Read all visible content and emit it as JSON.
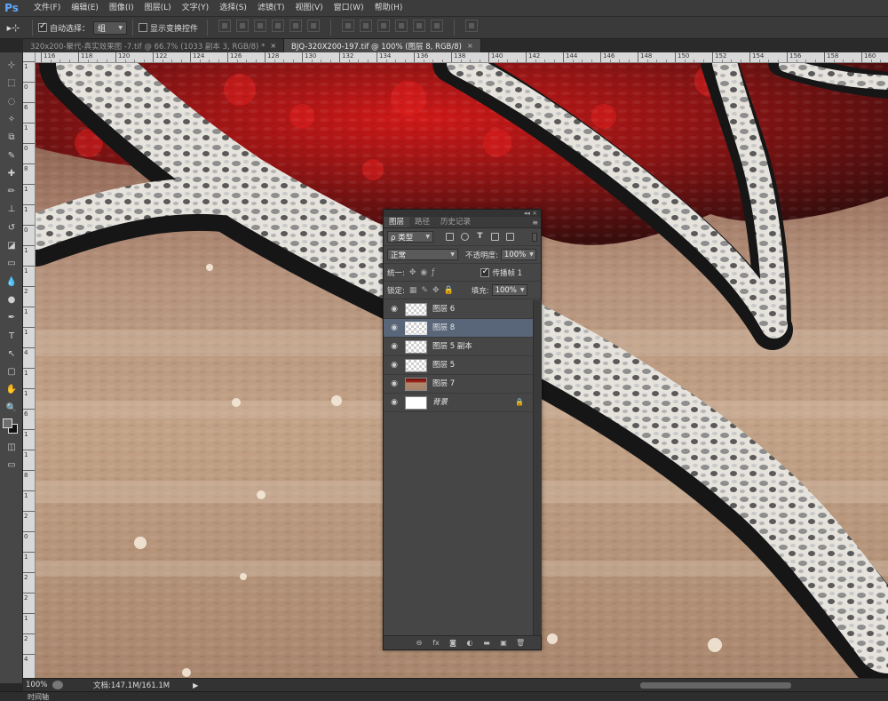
{
  "app": {
    "logo": "Ps"
  },
  "menus": [
    "文件(F)",
    "编辑(E)",
    "图像(I)",
    "图层(L)",
    "文字(Y)",
    "选择(S)",
    "滤镜(T)",
    "视图(V)",
    "窗口(W)",
    "帮助(H)"
  ],
  "options": {
    "move_tool_glyph": "▸⊹",
    "auto_select_label": "自动选择：",
    "auto_select_checked": true,
    "auto_select_target": "组",
    "show_transform_label": "显示变换控件",
    "show_transform_checked": false
  },
  "tabs": [
    {
      "label": "320x200-聚代-真实效果图 -7.tif @ 66.7% (1033 副本 3, RGB/8) *",
      "active": false,
      "close": "×"
    },
    {
      "label": "BJQ-320X200-197.tif @ 100% (图层 8, RGB/8)",
      "active": true,
      "close": "×"
    }
  ],
  "ruler": {
    "top_labels": [
      "116",
      "118",
      "120",
      "122",
      "124",
      "126",
      "128",
      "130",
      "132",
      "134",
      "136",
      "138",
      "140",
      "142",
      "144",
      "146",
      "148",
      "150",
      "152",
      "154",
      "156",
      "158",
      "160"
    ],
    "left_labels": [
      "1",
      "0",
      "6",
      "1",
      "0",
      "8",
      "1",
      "1",
      "0",
      "1",
      "1",
      "2",
      "1",
      "1",
      "4",
      "1",
      "1",
      "6",
      "1",
      "1",
      "8",
      "1",
      "2",
      "0",
      "1",
      "2",
      "2",
      "1",
      "2",
      "4"
    ]
  },
  "tools": [
    "move-icon",
    "marquee-icon",
    "lasso-icon",
    "magic-wand-icon",
    "crop-icon",
    "eyedropper-icon",
    "healing-brush-icon",
    "brush-icon",
    "clone-stamp-icon",
    "history-brush-icon",
    "eraser-icon",
    "gradient-icon",
    "blur-icon",
    "dodge-icon",
    "pen-icon",
    "type-icon",
    "path-selection-icon",
    "rectangle-shape-icon",
    "hand-icon",
    "zoom-icon"
  ],
  "tool_glyphs": [
    "⊹",
    "⬚",
    "◌",
    "✧",
    "⧉",
    "✎",
    "✚",
    "✏",
    "⊥",
    "↺",
    "◪",
    "▭",
    "💧",
    "●",
    "✒",
    "T",
    "↖",
    "▢",
    "✋",
    "🔍"
  ],
  "status": {
    "zoom": "100%",
    "doc_info": "文档:147.1M/161.1M",
    "arrow": "▶",
    "timeline": "时间轴"
  },
  "layers_panel": {
    "tabs": [
      "图层",
      "路径",
      "历史记录"
    ],
    "active_tab": 0,
    "collapse_glyphs": "◂◂  ×",
    "menu_glyph": "≡",
    "filter_kind": "ρ 类型",
    "blend_mode": "正常",
    "opacity_label": "不透明度:",
    "opacity_value": "100%",
    "unify_label": "统一:",
    "propagate_label": "传播帧 1",
    "propagate_checked": true,
    "lock_label": "锁定:",
    "fill_label": "填充:",
    "fill_value": "100%",
    "layers": [
      {
        "name": "图层 6",
        "visible": true,
        "selected": false,
        "thumb": "transparent",
        "locked": false
      },
      {
        "name": "图层 8",
        "visible": true,
        "selected": true,
        "thumb": "transparent",
        "locked": false
      },
      {
        "name": "图层 5 副本",
        "visible": true,
        "selected": false,
        "thumb": "transparent",
        "locked": false
      },
      {
        "name": "图层 5",
        "visible": true,
        "selected": false,
        "thumb": "transparent",
        "locked": false
      },
      {
        "name": "图层 7",
        "visible": true,
        "selected": false,
        "thumb": "image",
        "locked": false
      },
      {
        "name": "背景",
        "visible": true,
        "selected": false,
        "thumb": "white",
        "locked": true
      }
    ],
    "bottom_icons": [
      "link-layers-icon",
      "fx-icon",
      "add-mask-icon",
      "adjustment-layer-icon",
      "new-group-icon",
      "new-layer-icon",
      "delete-layer-icon"
    ],
    "bottom_glyphs": [
      "⊖",
      "fx",
      "◙",
      "◐",
      "▬",
      "▣",
      "🗑"
    ]
  },
  "colors": {
    "accent_selected_layer": "#596579",
    "canvas_tan": "#b29580",
    "branch_light": "#e9e6e0",
    "foliage_red": "#a71a18"
  }
}
